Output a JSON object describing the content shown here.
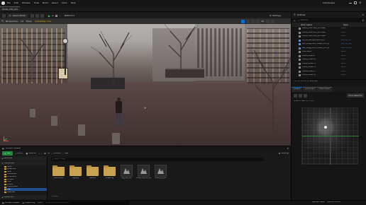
{
  "titlebar": {
    "project": "Small_City_LVL",
    "menus": [
      "File",
      "Edit",
      "Window",
      "Tools",
      "Build",
      "Select",
      "Actor",
      "Help"
    ],
    "right_text": "CitySample"
  },
  "toolbar": {
    "mode_label": "Select Mode",
    "platforms_label": "Platforms",
    "settings_label": "Settings"
  },
  "viewport": {
    "perspective_label": "Perspective",
    "lit_label": "Lit",
    "show_label": "Show",
    "scalability_label": "Scalability: Low",
    "zoom": "10"
  },
  "outliner": {
    "title": "Outliner",
    "search_placeholder": "Search...",
    "col_label": "Item Label",
    "col_type": "Type",
    "items": [
      {
        "label": "BLDG_OBSTSDS_BT548BY",
        "type": "Actor"
      },
      {
        "label": "BLDG_OBSTSDS_BT548BY",
        "type": "Actor"
      },
      {
        "label": "BLDG_OBSTSDS_BT548BY",
        "type": "Actor"
      },
      {
        "label": "BP_CitySampleWorldInfo",
        "type": "Edit BP_Cit"
      },
      {
        "label": "BPP_Bldg_Hero_Tower_CHC_A",
        "type": "Edit BP_Sin"
      },
      {
        "label": "BPP_Bldg_Hero_Tower_CHC_B",
        "type": "Edit BP_Sin"
      },
      {
        "label": "brain.ext4",
        "type": "Actor"
      },
      {
        "label": "CARS_CGNE0",
        "type": "Actor"
      },
      {
        "label": "CARS_CGNE70",
        "type": "Actor"
      },
      {
        "label": "CARS_CGNE71",
        "type": "Actor"
      },
      {
        "label": "CARS_CGNE72",
        "type": "Actor"
      },
      {
        "label": "CARS_CGNE73",
        "type": "Actor"
      },
      {
        "label": "CARS_CGNE74",
        "type": "Actor"
      }
    ],
    "actor_count": "11,570 actors (0 selected)"
  },
  "details": {
    "tabs": [
      "Details",
      "World Part",
      "World Setti"
    ],
    "zone_label": "Force Selection",
    "readout": "0.2km  1.0km  1.77 km"
  },
  "content_browser": {
    "title": "Content Browser",
    "add_label": "Add",
    "import_label": "Import",
    "save_label": "Save All",
    "path": [
      "All",
      "Content",
      "Map"
    ],
    "settings_label": "Settings",
    "favorites_label": "Favorites",
    "project_label": "CitySample",
    "tree": [
      "Audio",
      "Blueprints",
      "Build",
      "Characters",
      "Cinematics",
      "Content",
      "Core",
      "Effects",
      "Environment",
      "Map",
      "Materials"
    ],
    "collections_label": "Collections",
    "search_placeholder": "Search Map",
    "assets": [
      {
        "name": "Environment",
        "kind": "folder"
      },
      {
        "name": "Lighting",
        "kind": "folder"
      },
      {
        "name": "Material",
        "kind": "folder"
      },
      {
        "name": "Streaming",
        "kind": "folder"
      },
      {
        "name": "Big_City_LVL",
        "kind": "level"
      },
      {
        "name": "Small_City_LVL_BuiltData",
        "kind": "level"
      },
      {
        "name": "Small_City_LVL",
        "kind": "level"
      }
    ],
    "item_count": "7 items"
  },
  "statusbar": {
    "cb_label": "Content Drawer",
    "output_label": "Output Log",
    "cmd_label": "Cmd",
    "console_placeholder": "Enter Console Command",
    "right_text": "Derived Data",
    "source_label": "Source Control"
  },
  "colors": {
    "accent": "#0070e0",
    "folder": "#c8a24e",
    "add_button": "#1f8a3a"
  }
}
